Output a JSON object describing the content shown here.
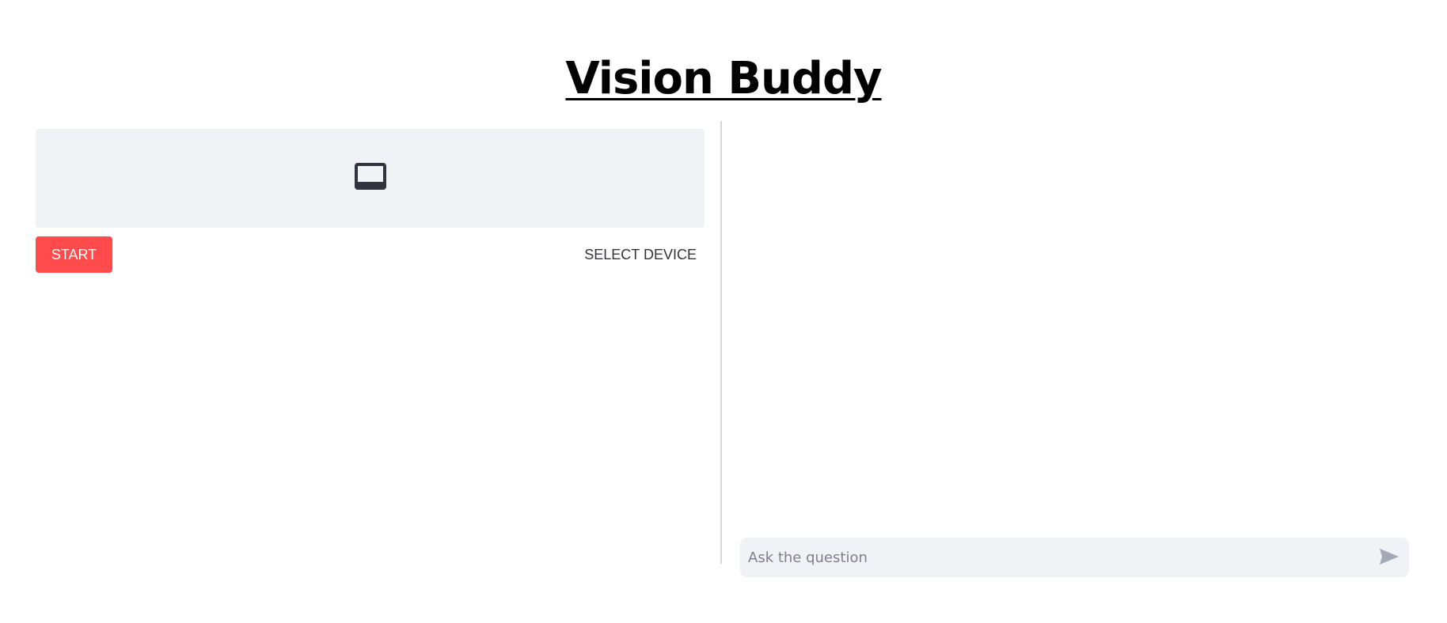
{
  "header": {
    "title": "Vision Buddy"
  },
  "video": {
    "placeholder_icon": "video-device-icon",
    "icon_color": "#31333f",
    "background": "#f0f2f6"
  },
  "controls": {
    "start_label": "START",
    "start_color": "#ff4b4b",
    "select_device_label": "SELECT DEVICE"
  },
  "chat": {
    "placeholder": "Ask the question",
    "send_icon": "send-icon",
    "send_icon_color": "#a3a8b8"
  }
}
